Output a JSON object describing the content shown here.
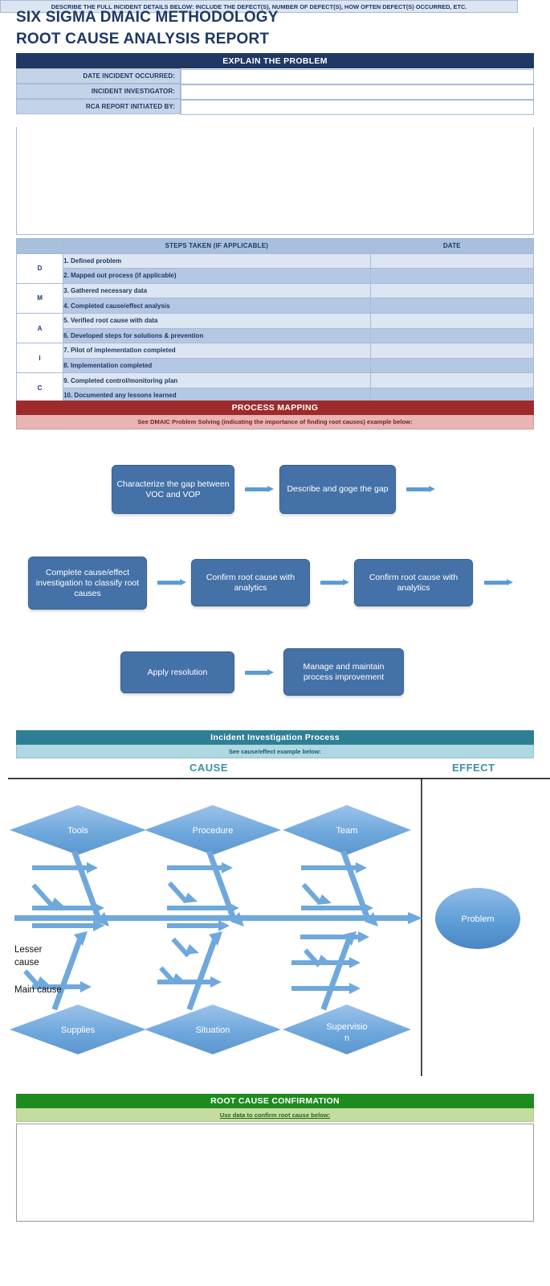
{
  "title": {
    "line1": "SIX SIGMA DMAIC METHODOLOGY",
    "line2": "ROOT CAUSE ANALYSIS REPORT"
  },
  "explain": {
    "header": "EXPLAIN THE PROBLEM",
    "fields": [
      {
        "label": "DATE INCIDENT OCCURRED:",
        "value": "",
        "placeholder": ""
      },
      {
        "label": "INCIDENT INVESTIGATOR:",
        "value": "",
        "placeholder": ""
      },
      {
        "label": "RCA REPORT INITIATED BY:",
        "value": "",
        "placeholder": ""
      }
    ],
    "describe_bar": "DESCRIBE THE FULL INCIDENT DETAILS BELOW: INCLUDE THE DEFECT(S), NUMBER OF DEFECT(S), HOW OFTEN DEFECT(S) OCCURRED, ETC.",
    "describe_value": ""
  },
  "steps": {
    "headers": [
      "",
      "STEPS TAKEN (IF APPLICABLE)",
      "DATE"
    ],
    "letters": [
      "D",
      "M",
      "A",
      "I",
      "C"
    ],
    "rows": [
      {
        "letter": "D",
        "step": "1. Defined problem",
        "date": ""
      },
      {
        "letter": "",
        "step": "2. Mapped out process (if applicable)",
        "date": ""
      },
      {
        "letter": "M",
        "step": "3. Gathered necessary data",
        "date": ""
      },
      {
        "letter": "",
        "step": "4. Completed cause/effect analysis",
        "date": ""
      },
      {
        "letter": "A",
        "step": "5. Verified root cause with data",
        "date": ""
      },
      {
        "letter": "",
        "step": "6. Developed steps for solutions & prevention",
        "date": ""
      },
      {
        "letter": "I",
        "step": "7. Pilot of implementation completed",
        "date": ""
      },
      {
        "letter": "",
        "step": "8. Implementation completed",
        "date": ""
      },
      {
        "letter": "C",
        "step": "9. Completed control/monitoring plan",
        "date": ""
      },
      {
        "letter": "",
        "step": "10. Documented any lessons learned",
        "date": ""
      }
    ]
  },
  "process_mapping": {
    "header": "PROCESS MAPPING",
    "subtitle": "See DMAIC Problem Solving (indicating the importance of finding root causes) example below:",
    "boxes": [
      {
        "text": "Characterize the gap between VOC and VOP"
      },
      {
        "text": "Describe and goge the gap"
      },
      {
        "text": "Complete cause/effect investigation to classify root causes"
      },
      {
        "text": "Confirm root cause with analytics"
      },
      {
        "text": "Confirm root cause with analytics"
      },
      {
        "text": "Apply resolution"
      },
      {
        "text": "Manage and maintain process improvement"
      }
    ]
  },
  "incident_investigation": {
    "header": "Incident Investigation Process",
    "subtitle": "See cause/effect example below:",
    "cause_label": "CAUSE",
    "effect_label": "EFFECT",
    "fishbone": {
      "top_categories": [
        "Tools",
        "Procedure",
        "Team"
      ],
      "bottom_categories": [
        "Supplies",
        "Situation",
        "Supervision"
      ],
      "effect_node": "Problem",
      "annotations": [
        "Lesser cause",
        "Main cause"
      ]
    }
  },
  "root_cause_confirmation": {
    "header": "ROOT CAUSE CONFIRMATION",
    "subtitle": "Use data to confirm root cause below:",
    "value": ""
  },
  "colors": {
    "navy": "#1F3864",
    "dark_red": "#9E2A2B",
    "teal": "#2E7F94",
    "green": "#1E8B1E",
    "flow_blue": "#4472A8",
    "arrow_blue": "#5B9BD5"
  }
}
